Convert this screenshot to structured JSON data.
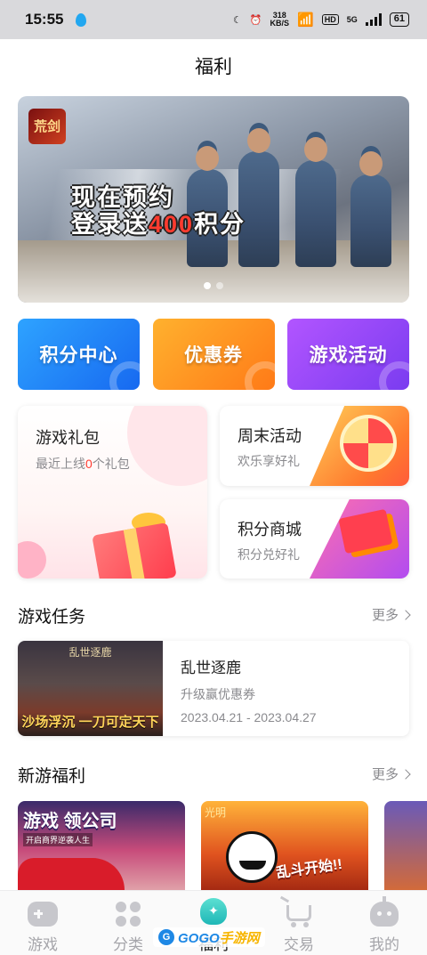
{
  "status_bar": {
    "time": "15:55",
    "speed_value": "318",
    "speed_unit": "KB/S",
    "hd": "HD",
    "network": "5G",
    "battery": "61"
  },
  "header": {
    "title": "福利"
  },
  "banner": {
    "logo_text": "荒剑",
    "line1": "现在预约",
    "line2_prefix": "登录送",
    "line2_highlight": "400",
    "line2_suffix": "积分",
    "slide_count": 2,
    "active_slide": 1
  },
  "quick_tiles": [
    {
      "label": "积分中心",
      "color": "#1f86f7"
    },
    {
      "label": "优惠券",
      "color": "#ff9a1f"
    },
    {
      "label": "游戏活动",
      "color": "#9847f7"
    }
  ],
  "cards": {
    "gift_pack": {
      "title": "游戏礼包",
      "subtitle_prefix": "最近上线",
      "count": "0",
      "subtitle_suffix": "个礼包"
    },
    "weekend": {
      "title": "周末活动",
      "subtitle": "欢乐享好礼"
    },
    "points_mall": {
      "title": "积分商城",
      "subtitle": "积分兑好礼"
    }
  },
  "tasks_section": {
    "title": "游戏任务",
    "more": "更多",
    "items": [
      {
        "thumb_title": "乱世逐鹿",
        "thumb_slogan": "沙场浮沉 一刀可定天下",
        "name": "乱世逐鹿",
        "desc": "升级赢优惠券",
        "date_range": "2023.04.21 - 2023.04.27"
      }
    ]
  },
  "new_games_section": {
    "title": "新游福利",
    "more": "更多",
    "items": [
      {
        "headline": "游戏 领公司",
        "caption": "开启商界逆袭人生"
      },
      {
        "logo": "光明",
        "slogan": "乱斗开始!!"
      },
      {}
    ]
  },
  "tabbar": {
    "tabs": [
      {
        "label": "游戏",
        "icon": "gamepad-icon",
        "active": false
      },
      {
        "label": "分类",
        "icon": "category-grid-icon",
        "active": false
      },
      {
        "label": "福利",
        "icon": "gift-bag-icon",
        "active": true
      },
      {
        "label": "交易",
        "icon": "cart-icon",
        "active": false
      },
      {
        "label": "我的",
        "icon": "profile-robot-icon",
        "active": false
      }
    ]
  },
  "watermark": {
    "disc": "G",
    "text_a": "GOGO",
    "text_b": "手游网"
  },
  "colors": {
    "accent_red": "#ff3b30",
    "muted_text": "#8a8a8e",
    "tab_active": "#111111"
  }
}
